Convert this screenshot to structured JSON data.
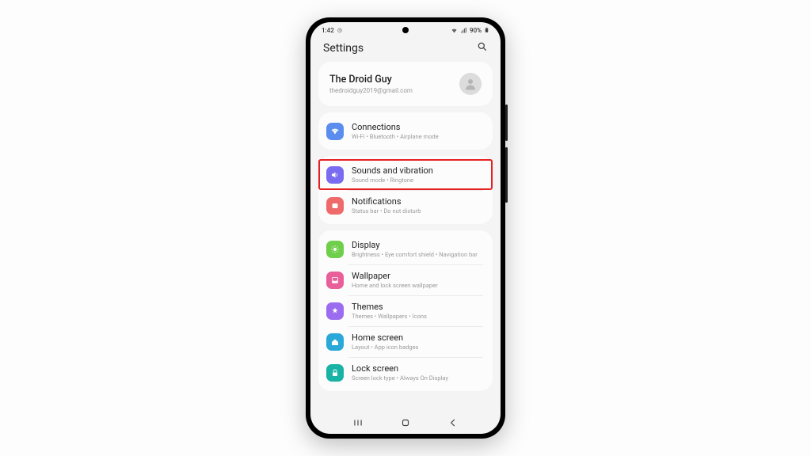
{
  "status": {
    "time": "1:42",
    "battery": "90%"
  },
  "appbar": {
    "title": "Settings"
  },
  "account": {
    "name": "The Droid Guy",
    "email": "thedroidguy2019@gmail.com"
  },
  "groups": [
    {
      "items": [
        {
          "icon": "wifi-icon",
          "color": "ic-blue",
          "title": "Connections",
          "sub": "Wi-Fi  •  Bluetooth  •  Airplane mode",
          "highlight": false
        }
      ]
    },
    {
      "items": [
        {
          "icon": "sound-icon",
          "color": "ic-purple",
          "title": "Sounds and vibration",
          "sub": "Sound mode  •  Ringtone",
          "highlight": true
        },
        {
          "icon": "notification-icon",
          "color": "ic-red",
          "title": "Notifications",
          "sub": "Status bar  •  Do not disturb",
          "highlight": false
        }
      ]
    },
    {
      "items": [
        {
          "icon": "display-icon",
          "color": "ic-green",
          "title": "Display",
          "sub": "Brightness  •  Eye comfort shield  •  Navigation bar",
          "highlight": false
        },
        {
          "icon": "wallpaper-icon",
          "color": "ic-pink",
          "title": "Wallpaper",
          "sub": "Home and lock screen wallpaper",
          "highlight": false
        },
        {
          "icon": "themes-icon",
          "color": "ic-violet",
          "title": "Themes",
          "sub": "Themes  •  Wallpapers  •  Icons",
          "highlight": false
        },
        {
          "icon": "home-icon",
          "color": "ic-cyan",
          "title": "Home screen",
          "sub": "Layout  •  App icon badges",
          "highlight": false
        },
        {
          "icon": "lock-icon",
          "color": "ic-teal",
          "title": "Lock screen",
          "sub": "Screen lock type  •  Always On Display",
          "highlight": false
        }
      ]
    }
  ]
}
